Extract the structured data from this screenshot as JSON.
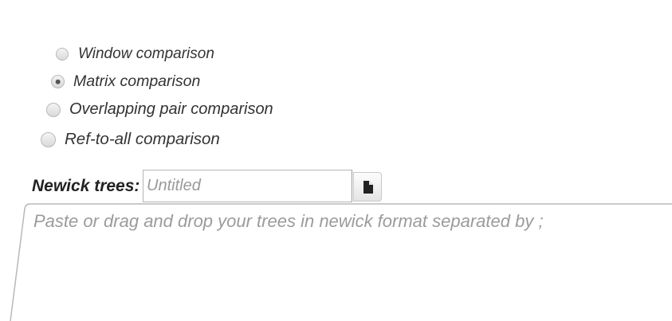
{
  "comparison_modes": [
    {
      "label": "Window comparison",
      "checked": false
    },
    {
      "label": "Matrix comparison",
      "checked": true
    },
    {
      "label": "Overlapping pair comparison",
      "checked": false
    },
    {
      "label": "Ref-to-all comparison",
      "checked": false
    }
  ],
  "newick": {
    "label": "Newick trees:",
    "name_placeholder": "Untitled",
    "file_icon": "file-icon",
    "trees_placeholder": "Paste or drag and drop your trees in newick format separated by ;"
  },
  "colors": {
    "border": "#b5b5b5",
    "placeholder": "#9b9b9b",
    "text": "#333333"
  }
}
